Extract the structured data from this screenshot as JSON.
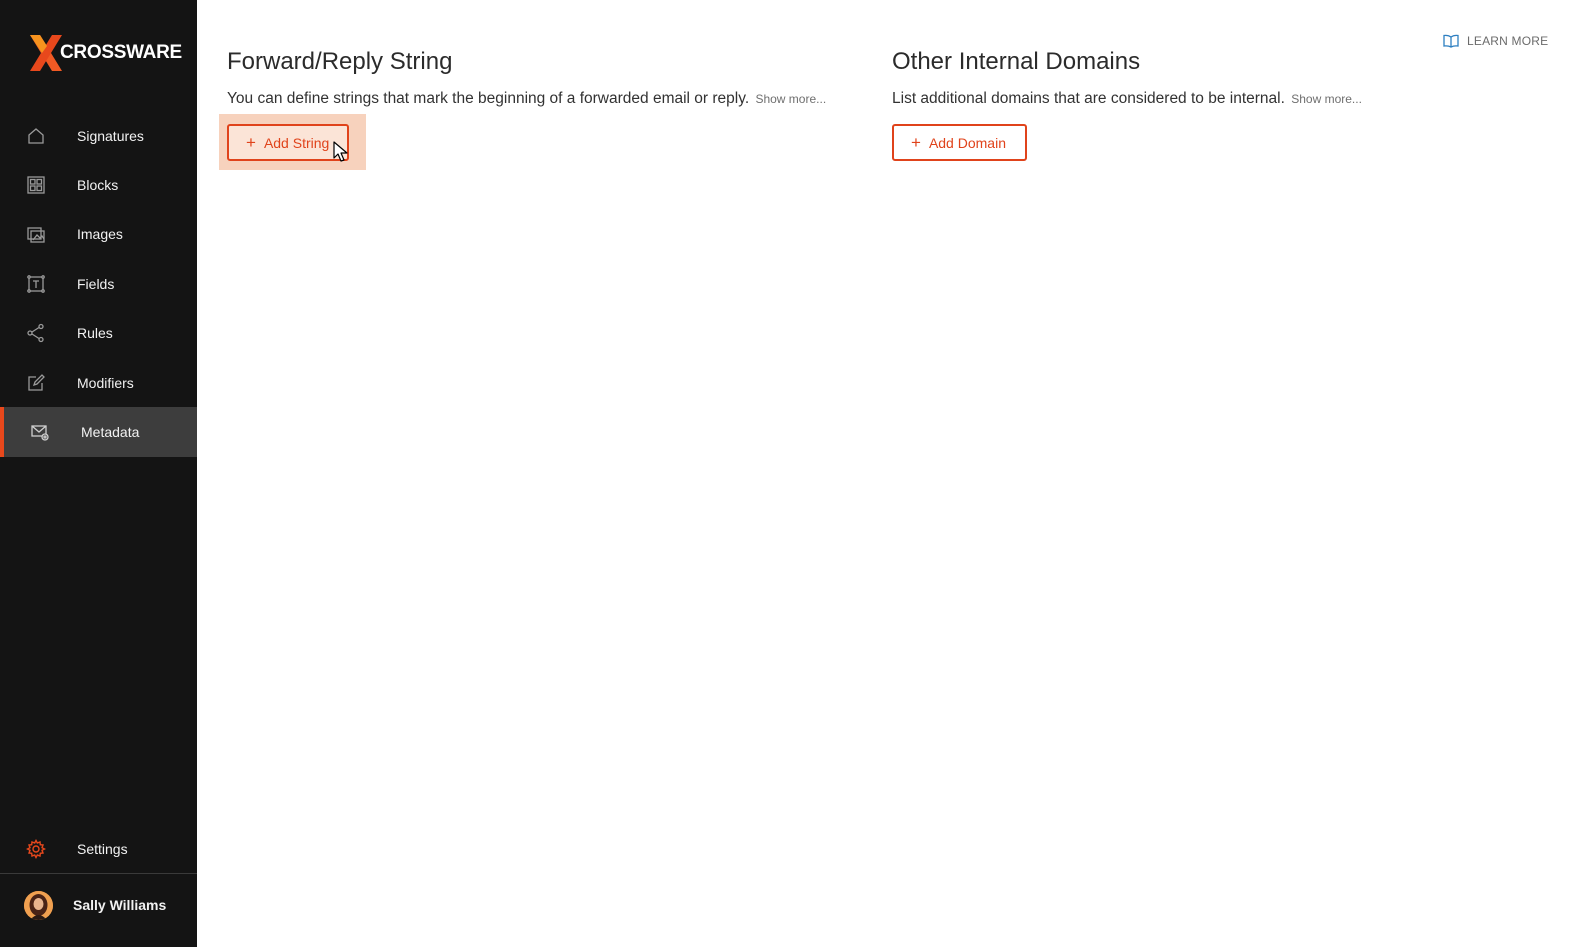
{
  "app": {
    "brand": "CROSSWARE",
    "accent_color": "#e0431b"
  },
  "sidebar": {
    "items": [
      {
        "label": "Signatures",
        "icon": "home-icon",
        "active": false
      },
      {
        "label": "Blocks",
        "icon": "blocks-grid-icon",
        "active": false
      },
      {
        "label": "Images",
        "icon": "images-icon",
        "active": false
      },
      {
        "label": "Fields",
        "icon": "text-field-icon",
        "active": false
      },
      {
        "label": "Rules",
        "icon": "share-nodes-icon",
        "active": false
      },
      {
        "label": "Modifiers",
        "icon": "edit-square-icon",
        "active": false
      },
      {
        "label": "Metadata",
        "icon": "mail-settings-icon",
        "active": true
      }
    ],
    "settings_label": "Settings",
    "user_name": "Sally Williams"
  },
  "header": {
    "learn_more_label": "LEARN MORE"
  },
  "sections": {
    "forward_reply": {
      "title": "Forward/Reply String",
      "description": "You can define strings that mark the beginning of a forwarded email or reply.",
      "show_more": "Show more...",
      "button_label": "Add String"
    },
    "internal_domains": {
      "title": "Other Internal Domains",
      "description": "List additional domains that are considered to be internal.",
      "show_more": "Show more...",
      "button_label": "Add Domain"
    }
  }
}
